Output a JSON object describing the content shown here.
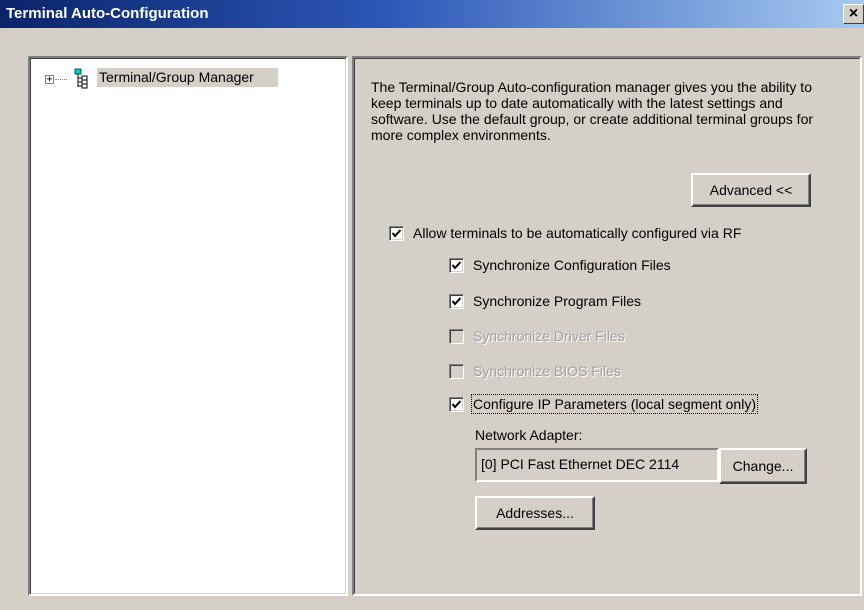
{
  "window": {
    "title": "Terminal Auto-Configuration",
    "close_label": "×"
  },
  "tree": {
    "expander": "+",
    "items": [
      {
        "label": "Terminal/Group Manager",
        "icon": "network-tree-icon",
        "selected": true
      }
    ]
  },
  "panel": {
    "description": "The Terminal/Group Auto-configuration manager gives you the ability to keep terminals up to date automatically with the latest settings and software.  Use the default group, or create additional terminal groups for more complex environments.",
    "advanced_button": "Advanced <<",
    "allow_rf": {
      "label": "Allow terminals to be automatically configured via RF",
      "checked": true
    },
    "options": [
      {
        "label": "Synchronize Configuration Files",
        "checked": true,
        "enabled": true
      },
      {
        "label": "Synchronize Program Files",
        "checked": true,
        "enabled": true
      },
      {
        "label": "Synchronize Driver Files",
        "checked": false,
        "enabled": false
      },
      {
        "label": "Synchronize BIOS Files",
        "checked": false,
        "enabled": false
      },
      {
        "label": "Configure IP Parameters (local segment only)",
        "checked": true,
        "enabled": true
      }
    ],
    "network_adapter_label": "Network Adapter:",
    "network_adapter_value": "[0] PCI Fast Ethernet DEC 2114",
    "change_button": "Change...",
    "addresses_button": "Addresses..."
  },
  "colors": {
    "title_start": "#0a246a",
    "title_end": "#a6caf0",
    "face": "#d4d0c8",
    "disabled_text": "#a0a0a0"
  }
}
